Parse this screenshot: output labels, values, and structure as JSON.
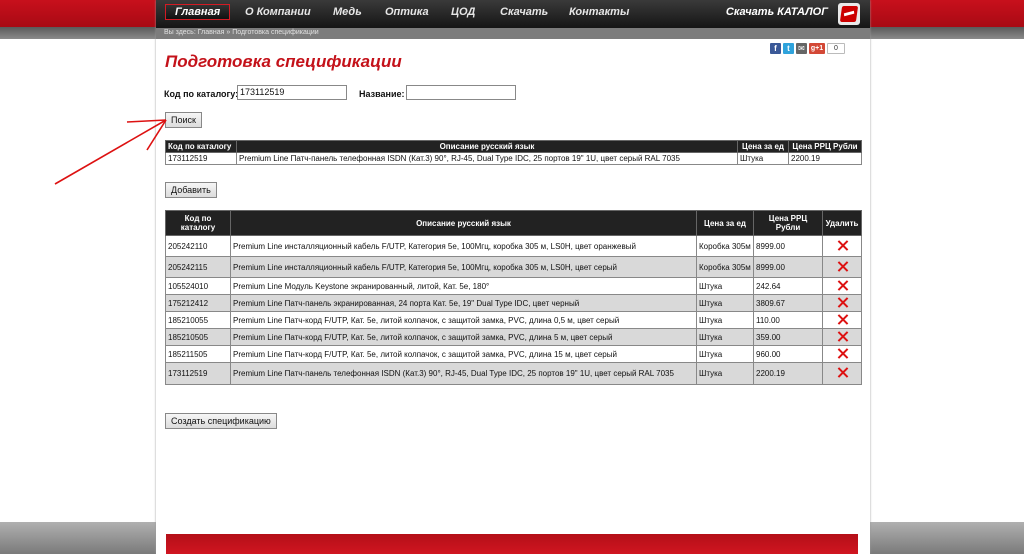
{
  "nav": {
    "items": [
      "Главная",
      "О Компании",
      "Медь",
      "Оптика",
      "ЦОД",
      "Скачать",
      "Контакты"
    ],
    "catalog": "Скачать КАТАЛОГ"
  },
  "breadcrumb": {
    "prefix": "Вы здесь:",
    "home": "Главная",
    "sep": "»",
    "current": "Подготовка спецификации"
  },
  "social": {
    "count": "0",
    "gplus": "g+1"
  },
  "page_title": "Подготовка спецификации",
  "search": {
    "code_label": "Код по каталогу:",
    "code_value": "173112519",
    "name_label": "Название:",
    "name_value": "",
    "search_button": "Поиск"
  },
  "result_table": {
    "headers": [
      "Код по каталогу",
      "Описание русский язык",
      "Цена за ед",
      "Цена РРЦ Рубли"
    ],
    "rows": [
      [
        "173112519",
        "Premium Line Патч-панель телефонная ISDN (Кат.3) 90°, RJ-45, Dual Type IDC, 25 портов 19\" 1U, цвет серый RAL 7035",
        "Штука",
        "2200.19"
      ]
    ]
  },
  "add_button": "Добавить",
  "spec_table": {
    "headers": [
      "Код по каталогу",
      "Описание русский язык",
      "Цена за ед",
      "Цена РРЦ Рубли",
      "Удалить"
    ],
    "rows": [
      [
        "205242110",
        "Premium Line инсталляционный кабель F/UTP, Категория 5е, 100Мгц, коробка 305 м, LS0H, цвет оранжевый",
        "Коробка 305м",
        "8999.00"
      ],
      [
        "205242115",
        "Premium Line инсталляционный кабель F/UTP, Категория 5е, 100Мгц, коробка 305 м, LS0H, цвет серый",
        "Коробка 305м",
        "8999.00"
      ],
      [
        "105524010",
        "Premium Line Модуль Keystone экранированный, литой, Кат. 5е, 180°",
        "Штука",
        "242.64"
      ],
      [
        "175212412",
        "Premium Line Патч-панель экранированная, 24 порта Кат. 5е, 19\" Dual Type IDC, цвет черный",
        "Штука",
        "3809.67"
      ],
      [
        "185210055",
        "Premium Line Патч-корд F/UTP, Кат. 5е, литой колпачок, с защитой замка, PVC, длина 0,5 м, цвет серый",
        "Штука",
        "110.00"
      ],
      [
        "185210505",
        "Premium Line Патч-корд F/UTP, Кат. 5е, литой колпачок, с защитой замка, PVC, длина 5 м, цвет серый",
        "Штука",
        "359.00"
      ],
      [
        "185211505",
        "Premium Line Патч-корд F/UTP, Кат. 5е, литой колпачок, с защитой замка, PVC, длина 15 м, цвет серый",
        "Штука",
        "960.00"
      ],
      [
        "173112519",
        "Premium Line Патч-панель телефонная ISDN (Кат.3) 90°, RJ-45, Dual Type IDC, 25 портов 19\" 1U, цвет серый RAL 7035",
        "Штука",
        "2200.19"
      ]
    ]
  },
  "create_button": "Создать спецификацию",
  "colors": {
    "accent": "#c4121a",
    "nav": "#1e1e1e",
    "header": "#222222"
  }
}
